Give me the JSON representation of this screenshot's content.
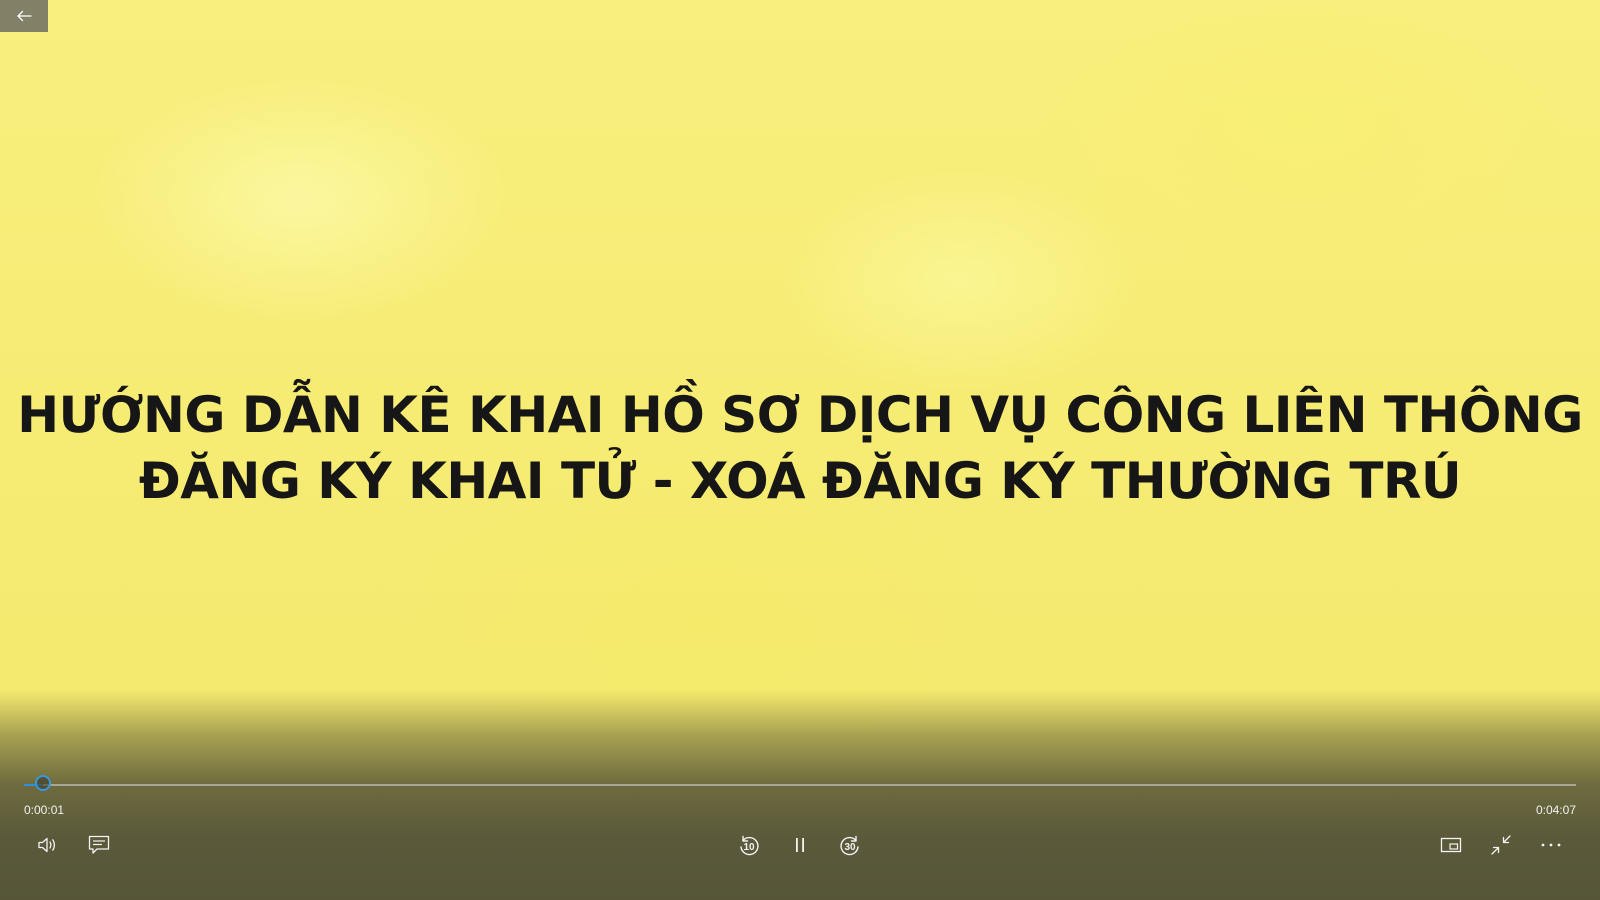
{
  "video": {
    "title_lines": [
      "HƯỚNG DẪN KÊ KHAI HỒ SƠ DỊCH VỤ CÔNG LIÊN THÔNG",
      "ĐĂNG KÝ KHAI TỬ - XOÁ ĐĂNG KÝ THƯỜNG TRÚ"
    ]
  },
  "playback": {
    "elapsed": "0:00:01",
    "total": "0:04:07",
    "progress_fraction": 0.012,
    "state": "playing"
  },
  "controls": {
    "skip_back_seconds": "10",
    "skip_forward_seconds": "30"
  },
  "colors": {
    "accent": "#2f8fd8",
    "background_yellow": "#f6ec74",
    "title_text": "#161616"
  },
  "icons": {
    "back": "arrow-left-icon",
    "volume": "volume-icon",
    "subtitles": "subtitles-icon",
    "skip_back": "skip-back-icon",
    "pause": "pause-icon",
    "skip_forward": "skip-forward-icon",
    "mini_view": "mini-view-icon",
    "exit_fullscreen": "exit-fullscreen-icon",
    "more": "more-options-icon"
  }
}
